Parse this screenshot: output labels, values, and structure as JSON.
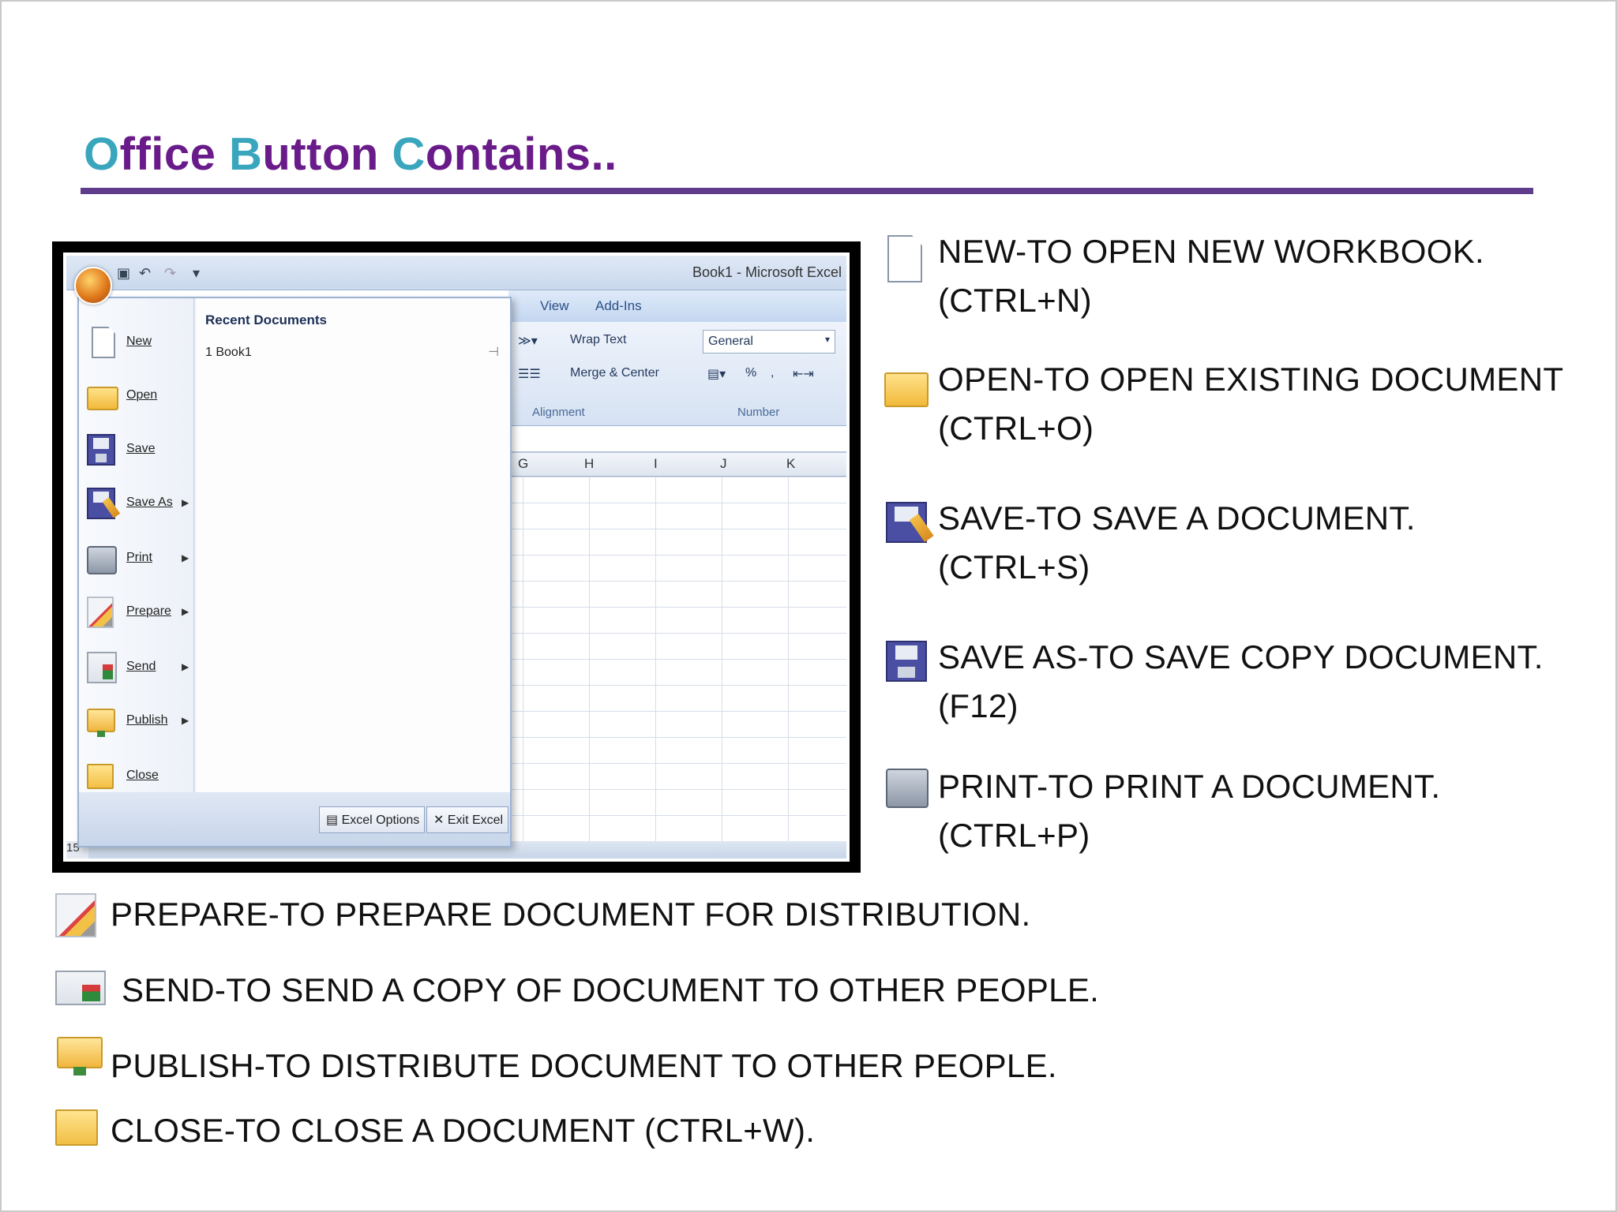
{
  "title": {
    "parts": [
      {
        "text": "O",
        "style": "cap"
      },
      {
        "text": "ffice ",
        "style": "rest"
      },
      {
        "text": "B",
        "style": "cap"
      },
      {
        "text": "utton ",
        "style": "rest"
      },
      {
        "text": "C",
        "style": "cap"
      },
      {
        "text": "ontains..",
        "style": "rest"
      }
    ]
  },
  "colors": {
    "title_accent": "#3aa6be",
    "title_main": "#6a1b8a",
    "rule": "#5f3d8c"
  },
  "excel": {
    "window_title": "Book1 - Microsoft Excel",
    "tabs": [
      "View",
      "Add-Ins"
    ],
    "ribbon": {
      "wrap_text": "Wrap Text",
      "merge_center": "Merge & Center",
      "number_format": "General",
      "percent": "%",
      "comma": ",",
      "group_alignment": "Alignment",
      "group_number": "Number"
    },
    "columns": [
      "G",
      "H",
      "I",
      "J",
      "K"
    ],
    "row_number": "15",
    "menu": {
      "items": [
        {
          "label": "New",
          "icon": "new-doc-icon",
          "arrow": false
        },
        {
          "label": "Open",
          "icon": "open-folder-icon",
          "arrow": false
        },
        {
          "label": "Save",
          "icon": "save-icon",
          "arrow": false
        },
        {
          "label": "Save As",
          "icon": "save-as-icon",
          "arrow": true
        },
        {
          "label": "Print",
          "icon": "printer-icon",
          "arrow": true
        },
        {
          "label": "Prepare",
          "icon": "prepare-icon",
          "arrow": true
        },
        {
          "label": "Send",
          "icon": "send-icon",
          "arrow": true
        },
        {
          "label": "Publish",
          "icon": "publish-icon",
          "arrow": true
        },
        {
          "label": "Close",
          "icon": "close-folder-icon",
          "arrow": false
        }
      ],
      "recent_title": "Recent Documents",
      "recent_item": "1  Book1",
      "excel_options": "Excel Options",
      "exit_excel": "Exit Excel"
    }
  },
  "descriptions": {
    "new": {
      "line1": "NEW-TO OPEN NEW WORKBOOK.",
      "line2": "(CTRL+N)"
    },
    "open": {
      "line1": "OPEN-TO OPEN EXISTING DOCUMENT",
      "line2": "(CTRL+O)"
    },
    "save": {
      "line1": "SAVE-TO SAVE A DOCUMENT.",
      "line2": "(CTRL+S)"
    },
    "save_as": {
      "line1": "SAVE AS-TO SAVE COPY DOCUMENT.",
      "line2": "(F12)"
    },
    "print": {
      "line1": "PRINT-TO PRINT A DOCUMENT.",
      "line2": "(CTRL+P)"
    },
    "prepare": "PREPARE-TO PREPARE DOCUMENT FOR DISTRIBUTION.",
    "send": "SEND-TO SEND A COPY OF DOCUMENT  TO OTHER PEOPLE.",
    "publish": "PUBLISH-TO DISTRIBUTE DOCUMENT  TO OTHER PEOPLE.",
    "close": "CLOSE-TO CLOSE A DOCUMENT  (CTRL+W)."
  }
}
